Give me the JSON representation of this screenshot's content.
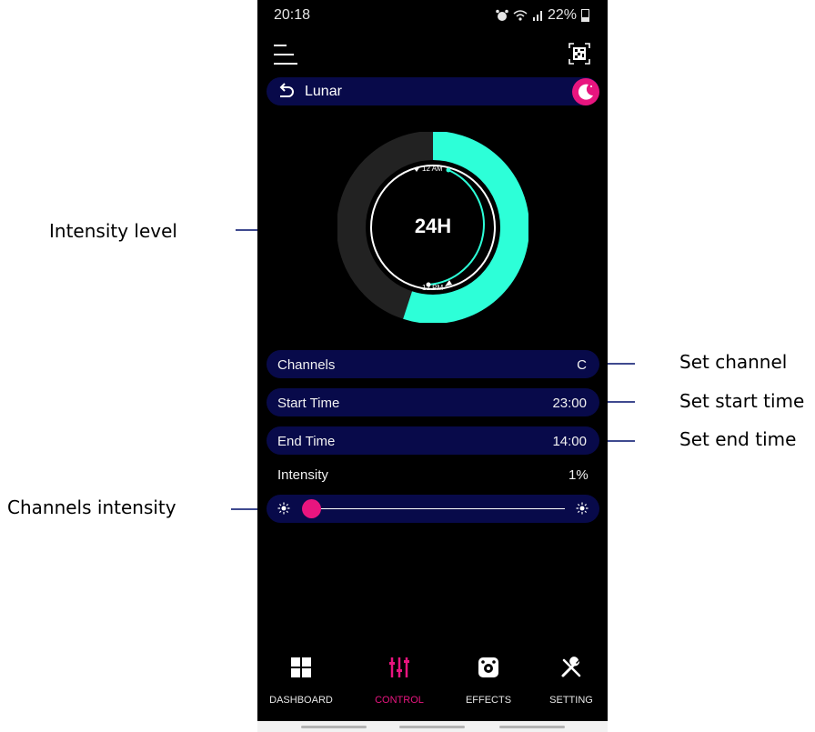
{
  "status_bar": {
    "time": "20:18",
    "battery": "22%"
  },
  "header": {
    "title": "Lunar"
  },
  "dial": {
    "center_label": "24H",
    "top_tick": "12 AM",
    "bottom_tick": "12 PM",
    "active_fraction": 0.55,
    "active_color": "#2dffd8",
    "inactive_color": "#222222"
  },
  "settings": {
    "channels": {
      "label": "Channels",
      "value": "C"
    },
    "start_time": {
      "label": "Start Time",
      "value": "23:00"
    },
    "end_time": {
      "label": "End Time",
      "value": "14:00"
    }
  },
  "intensity": {
    "label": "Intensity",
    "value": "1%",
    "level": 0.01
  },
  "bottom_nav": {
    "items": [
      {
        "label": "DASHBOARD",
        "icon": "grid-icon",
        "active": false
      },
      {
        "label": "CONTROL",
        "icon": "sliders-icon",
        "active": true
      },
      {
        "label": "EFFECTS",
        "icon": "effects-icon",
        "active": false
      },
      {
        "label": "SETTING",
        "icon": "wrench-icon",
        "active": false
      }
    ]
  },
  "annotations": {
    "intensity_level": "Intensity level",
    "channels_intensity": "Channels intensity",
    "set_channel": "Set channel",
    "set_start_time": "Set start time",
    "set_end_time": "Set end time"
  },
  "colors": {
    "accent": "#e8157f",
    "bar": "#080a4a",
    "teal": "#2dffd8",
    "callout_line": "#3f4a8f"
  }
}
